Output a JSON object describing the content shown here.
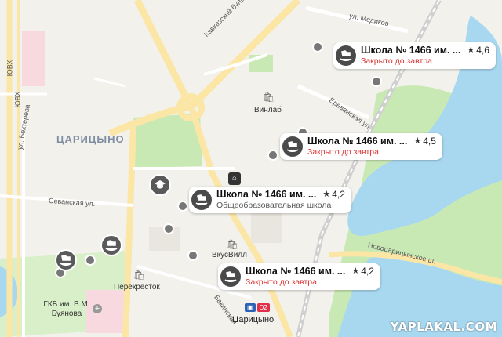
{
  "map": {
    "district": "ЦАРИЦЫНО",
    "streets": {
      "kavkazsky": "Кавказский бульв.",
      "medikov": "ул. Медиков",
      "erevanskaya": "Ереванская ул.",
      "bekhtereva": "ул. Бехтерева",
      "sevanskaya": "Севанская ул.",
      "novotsaritsynskoe": "Новоцарицынское ш.",
      "bakinskaya": "Бакинская",
      "yuvkh1": "ЮВХ",
      "yuvkh2": "ЮВХ"
    },
    "pois": {
      "vinlab": "Винлаб",
      "vkusvill": "ВкусВилл",
      "perekrestok": "Перекрёсток",
      "hospital": "ГКБ им. В.М. Буянова"
    },
    "metro": {
      "name": "Царицыно",
      "badge_1": "▣",
      "badge_2": "D2"
    },
    "colors": {
      "land": "#f3f1ec",
      "park": "#c9e9b4",
      "water": "#a8d8f0",
      "road": "#ffffff",
      "major_road": "#fbe6a6",
      "status_red": "#d33"
    }
  },
  "cards": [
    {
      "name": "Школа № 1466 им. ...",
      "rating": "4,6",
      "status": "Закрыто до завтра"
    },
    {
      "name": "Школа № 1466 им. ...",
      "rating": "4,5",
      "status": "Закрыто до завтра"
    },
    {
      "name": "Школа № 1466 им. ...",
      "rating": "4,2",
      "status": "Общеобразовательная школа"
    },
    {
      "name": "Школа № 1466 им. ...",
      "rating": "4,2",
      "status": "Закрыто до завтра"
    }
  ],
  "watermark": "YAPLAKAL.COM",
  "icons": {
    "horse": "rocking-horse-icon",
    "star": "star-icon",
    "shop": "shopping-bag-icon",
    "hospital": "cross-icon",
    "school": "house-icon"
  }
}
